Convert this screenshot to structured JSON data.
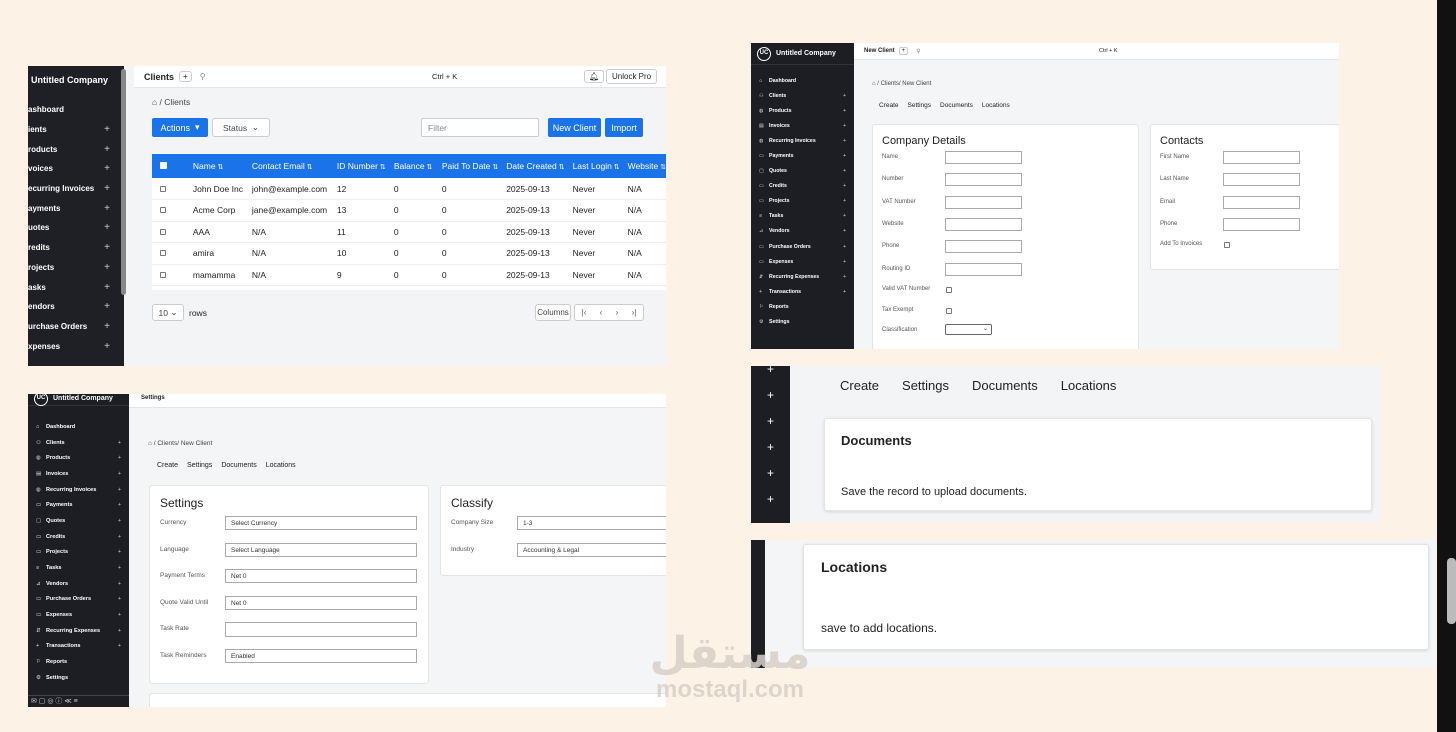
{
  "company": "Untitled Company",
  "sidebar_items": [
    {
      "label": "Dashboard",
      "icon": "dashboard-icon",
      "glyph": "⌂",
      "plus": false
    },
    {
      "label": "Clients",
      "icon": "clients-icon",
      "glyph": "⚇",
      "plus": true
    },
    {
      "label": "Products",
      "icon": "products-icon",
      "glyph": "◍",
      "plus": true
    },
    {
      "label": "Invoices",
      "icon": "invoices-icon",
      "glyph": "▤",
      "plus": true
    },
    {
      "label": "Recurring Invoices",
      "icon": "recurring-invoices-icon",
      "glyph": "◍",
      "plus": true
    },
    {
      "label": "Payments",
      "icon": "payments-icon",
      "glyph": "▭",
      "plus": true
    },
    {
      "label": "Quotes",
      "icon": "quotes-icon",
      "glyph": "▢",
      "plus": true
    },
    {
      "label": "Credits",
      "icon": "credits-icon",
      "glyph": "▭",
      "plus": true
    },
    {
      "label": "Projects",
      "icon": "projects-icon",
      "glyph": "▭",
      "plus": true
    },
    {
      "label": "Tasks",
      "icon": "tasks-icon",
      "glyph": "≡",
      "plus": true
    },
    {
      "label": "Vendors",
      "icon": "vendors-icon",
      "glyph": "⊿",
      "plus": true
    },
    {
      "label": "Purchase Orders",
      "icon": "purchase-orders-icon",
      "glyph": "▭",
      "plus": true
    },
    {
      "label": "Expenses",
      "icon": "expenses-icon",
      "glyph": "▭",
      "plus": true
    },
    {
      "label": "Recurring Expenses",
      "icon": "recurring-expenses-icon",
      "glyph": "⇵",
      "plus": true
    },
    {
      "label": "Transactions",
      "icon": "transactions-icon",
      "glyph": "+",
      "plus": true
    },
    {
      "label": "Reports",
      "icon": "reports-icon",
      "glyph": "⚐",
      "plus": false
    },
    {
      "label": "Settings",
      "icon": "settings-icon",
      "glyph": "⚙",
      "plus": false
    }
  ],
  "p1": {
    "title": "Clients",
    "shortcut": "Ctrl + K",
    "unlock": "Unlock Pro",
    "breadcrumb": "/ Clients",
    "actions": "Actions",
    "status": "Status",
    "filter": "Filter",
    "new_client": "New Client",
    "import": "Import",
    "side_labels": [
      "ashboard",
      "ients",
      "roducts",
      "voices",
      "ecurring Invoices",
      "ayments",
      "uotes",
      "redits",
      "rojects",
      "asks",
      "endors",
      "urchase Orders",
      "xpenses"
    ],
    "columns": [
      "Name",
      "Contact Email",
      "ID Number",
      "Balance",
      "Paid To Date",
      "Date Created",
      "Last Login",
      "Website"
    ],
    "rows": [
      [
        "John Doe Inc",
        "john@example.com",
        "12",
        "0",
        "0",
        "2025-09-13",
        "Never",
        "N/A"
      ],
      [
        "Acme Corp",
        "jane@example.com",
        "13",
        "0",
        "0",
        "2025-09-13",
        "Never",
        "N/A"
      ],
      [
        "AAA",
        "N/A",
        "11",
        "0",
        "0",
        "2025-09-13",
        "Never",
        "N/A"
      ],
      [
        "amira",
        "N/A",
        "10",
        "0",
        "0",
        "2025-09-13",
        "Never",
        "N/A"
      ],
      [
        "mamamma",
        "N/A",
        "9",
        "0",
        "0",
        "2025-09-13",
        "Never",
        "N/A"
      ]
    ],
    "rows_per_page": "10",
    "rows_label": "rows",
    "columns_btn": "Columns"
  },
  "p2": {
    "title": "New Client",
    "shortcut": "Ctrl + K",
    "breadcrumb": "/ Clients/ New Client",
    "tabs": [
      "Create",
      "Settings",
      "Documents",
      "Locations"
    ],
    "company_title": "Company Details",
    "company_fields": [
      "Name",
      "Number",
      "VAT Number",
      "Website",
      "Phone",
      "Routing ID"
    ],
    "valid_vat": "Valid VAT Number",
    "tax_exempt": "Tax Exempt",
    "classification": "Classification",
    "contacts_title": "Contacts",
    "contact_fields": [
      "First Name",
      "Last Name",
      "Email",
      "Phone"
    ],
    "add_to_invoices": "Add To Invoices"
  },
  "p3": {
    "title": "Settings",
    "breadcrumb": "/ Clients/ New Client",
    "tabs": [
      "Create",
      "Settings",
      "Documents",
      "Locations"
    ],
    "settings_title": "Settings",
    "settings_rows": [
      {
        "label": "Currency",
        "value": "Select Currency"
      },
      {
        "label": "Language",
        "value": "Select Language"
      },
      {
        "label": "Payment Terms",
        "value": "Net 0"
      },
      {
        "label": "Quote Valid Until",
        "value": "Net 0"
      },
      {
        "label": "Task Rate",
        "value": ""
      },
      {
        "label": "Task Reminders",
        "value": "Enabled"
      }
    ],
    "classify_title": "Classify",
    "classify_rows": [
      {
        "label": "Company Size",
        "value": "1-3"
      },
      {
        "label": "Industry",
        "value": "Accounting & Legal"
      }
    ]
  },
  "p4": {
    "tabs": [
      "Create",
      "Settings",
      "Documents",
      "Locations"
    ],
    "documents_title": "Documents",
    "documents_text": "Save the record to upload documents."
  },
  "p5": {
    "locations_title": "Locations",
    "locations_text": "save to add locations."
  },
  "watermark": {
    "arabic": "مستقل",
    "latin": "mostaql.com"
  }
}
